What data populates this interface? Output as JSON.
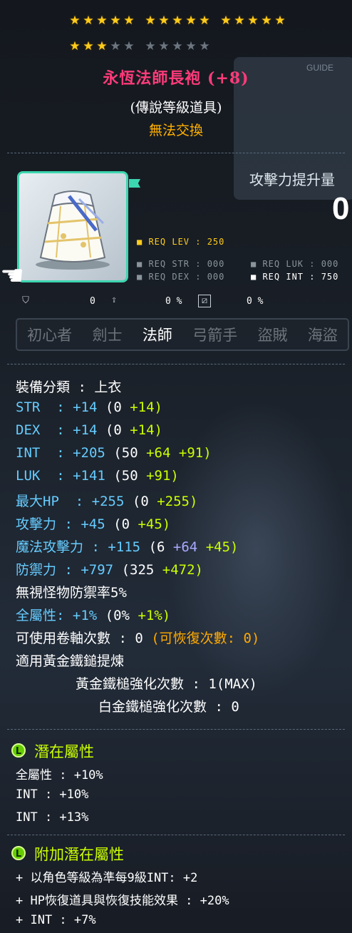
{
  "stars": {
    "total": 25,
    "filled": 18
  },
  "item": {
    "name": "永恆法師長袍 (+8)",
    "grade": "(傳說等級道具)",
    "trade": "無法交換"
  },
  "requirements": {
    "level": "■ REQ LEV : 250",
    "str": "■ REQ STR : 000",
    "luk": "■ REQ LUK : 000",
    "dex": "■ REQ DEX : 000",
    "int": "■ REQ INT : 750"
  },
  "misc_icons": {
    "value1": "0",
    "value2": "0 %",
    "value3": "0 %"
  },
  "jobs": [
    {
      "label": "初心者",
      "active": false
    },
    {
      "label": "劍士",
      "active": false
    },
    {
      "label": "法師",
      "active": true
    },
    {
      "label": "弓箭手",
      "active": false
    },
    {
      "label": "盜賊",
      "active": false
    },
    {
      "label": "海盜",
      "active": false
    }
  ],
  "stats": {
    "category": "裝備分類 : 上衣",
    "str": {
      "label": "STR",
      "total": ": +14",
      "base": "(0",
      "bonus": "+14)"
    },
    "dex": {
      "label": "DEX",
      "total": ": +14",
      "base": "(0",
      "bonus": "+14)"
    },
    "int": {
      "label": "INT",
      "total": ": +205",
      "base": "(50",
      "scroll": "+64",
      "bonus": "+91)"
    },
    "luk": {
      "label": "LUK",
      "total": ": +141",
      "base": "(50",
      "bonus": "+91)"
    },
    "hp": {
      "label": "最大HP",
      "total": ": +255",
      "base": "(0",
      "bonus": "+255)"
    },
    "atk": {
      "label": "攻擊力",
      "total": ": +45",
      "base": "(0",
      "bonus": "+45)"
    },
    "matk": {
      "label": "魔法攻擊力",
      "total": ": +115",
      "base": "(6",
      "scroll": "+64",
      "bonus": "+45)"
    },
    "def": {
      "label": "防禦力",
      "total": ": +797",
      "base": "(325",
      "bonus": "+472)"
    },
    "ignore_def": "無視怪物防禦率5%",
    "allstat": {
      "label": "全屬性",
      "total": ": +1%",
      "base": "(0%",
      "bonus": "+1%)"
    },
    "upgrades": "可使用卷軸次數 : 0",
    "recover": "(可恢復次數: 0)",
    "hammer": "適用黃金鐵鎚提煉",
    "gold_hammer": "黃金鐵槌強化次數 : 1(MAX)",
    "plat_hammer": "白金鐵槌強化次數 : 0"
  },
  "potential": {
    "badge": "L",
    "title": "潛在屬性",
    "lines": [
      "全屬性 : +10%",
      "INT : +10%",
      "INT : +13%"
    ]
  },
  "bonus_potential": {
    "badge": "L",
    "title": "附加潛在屬性",
    "lines": [
      "+ 以角色等級為準每9級INT: +2",
      "+ HP恢復道具與恢復技能效果 : +20%",
      "+ INT : +7%"
    ]
  },
  "background": {
    "panel_text": "攻擊力提升量",
    "big_digit": "0",
    "guide": "GUIDE"
  },
  "colors": {
    "title": "#ff3b7a",
    "untradeable": "#ffb000",
    "stat_cyan": "#66ccff",
    "bonus_green": "#ccff00",
    "scroll_purple": "#aaaaff",
    "border_legendary": "#3cd6b0"
  }
}
